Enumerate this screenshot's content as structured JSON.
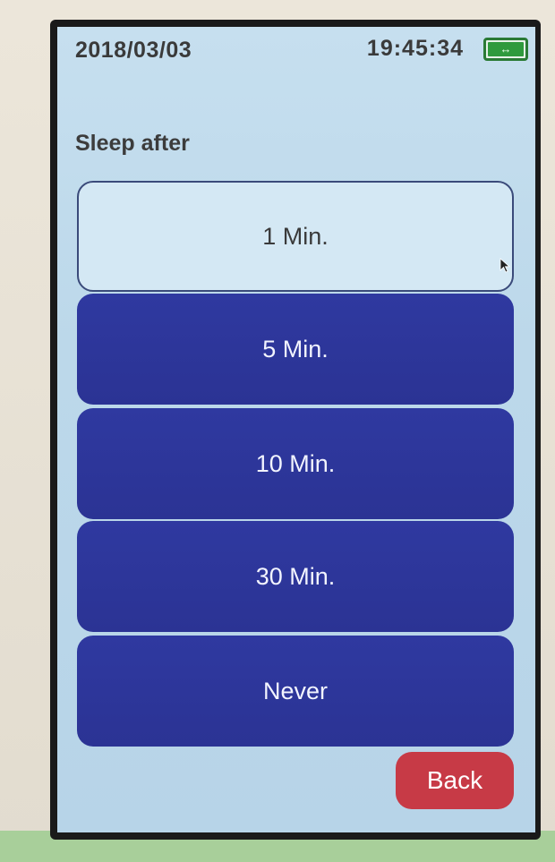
{
  "status_bar": {
    "date": "2018/03/03",
    "time": "19:45:34",
    "battery_icon": "battery-charging-icon",
    "battery_glyph": "↔"
  },
  "screen": {
    "title": "Sleep after"
  },
  "options": [
    {
      "label": "1 Min.",
      "selected": true
    },
    {
      "label": "5 Min.",
      "selected": false
    },
    {
      "label": "10 Min.",
      "selected": false
    },
    {
      "label": "30 Min.",
      "selected": false
    },
    {
      "label": "Never",
      "selected": false
    }
  ],
  "back_button": {
    "label": "Back"
  },
  "colors": {
    "screen_background": "#c0dbec",
    "option_selected_background": "#d4e8f4",
    "option_unselected_background": "#2f39a0",
    "back_button": "#c73a46",
    "battery": "#2f9a3d"
  }
}
